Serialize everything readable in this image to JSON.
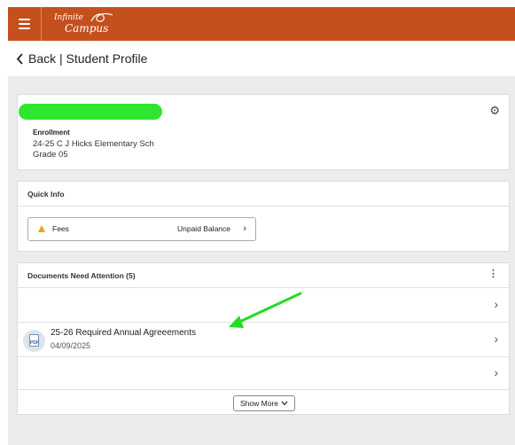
{
  "header": {
    "logo_line1": "Infinite",
    "logo_line2": "Campus",
    "brand_color": "#c4501e"
  },
  "nav": {
    "back_label": "Back | Student Profile"
  },
  "profile": {
    "enrollment_label": "Enrollment",
    "school": "24-25 C J Hicks Elementary Sch",
    "grade": "Grade 05"
  },
  "quick_info": {
    "title": "Quick Info",
    "fees_label": "Fees",
    "fees_status": "Unpaid Balance"
  },
  "documents": {
    "title": "Documents Need Attention (5)",
    "items": [
      {
        "title": "",
        "date": ""
      },
      {
        "title": "25-26 Required Annual Agreeements",
        "date": "04/09/2025"
      },
      {
        "title": "",
        "date": ""
      }
    ],
    "show_more_label": "Show More"
  },
  "annotation": {
    "arrow_color": "#22dd22",
    "redaction_color": "#2ee62e"
  }
}
